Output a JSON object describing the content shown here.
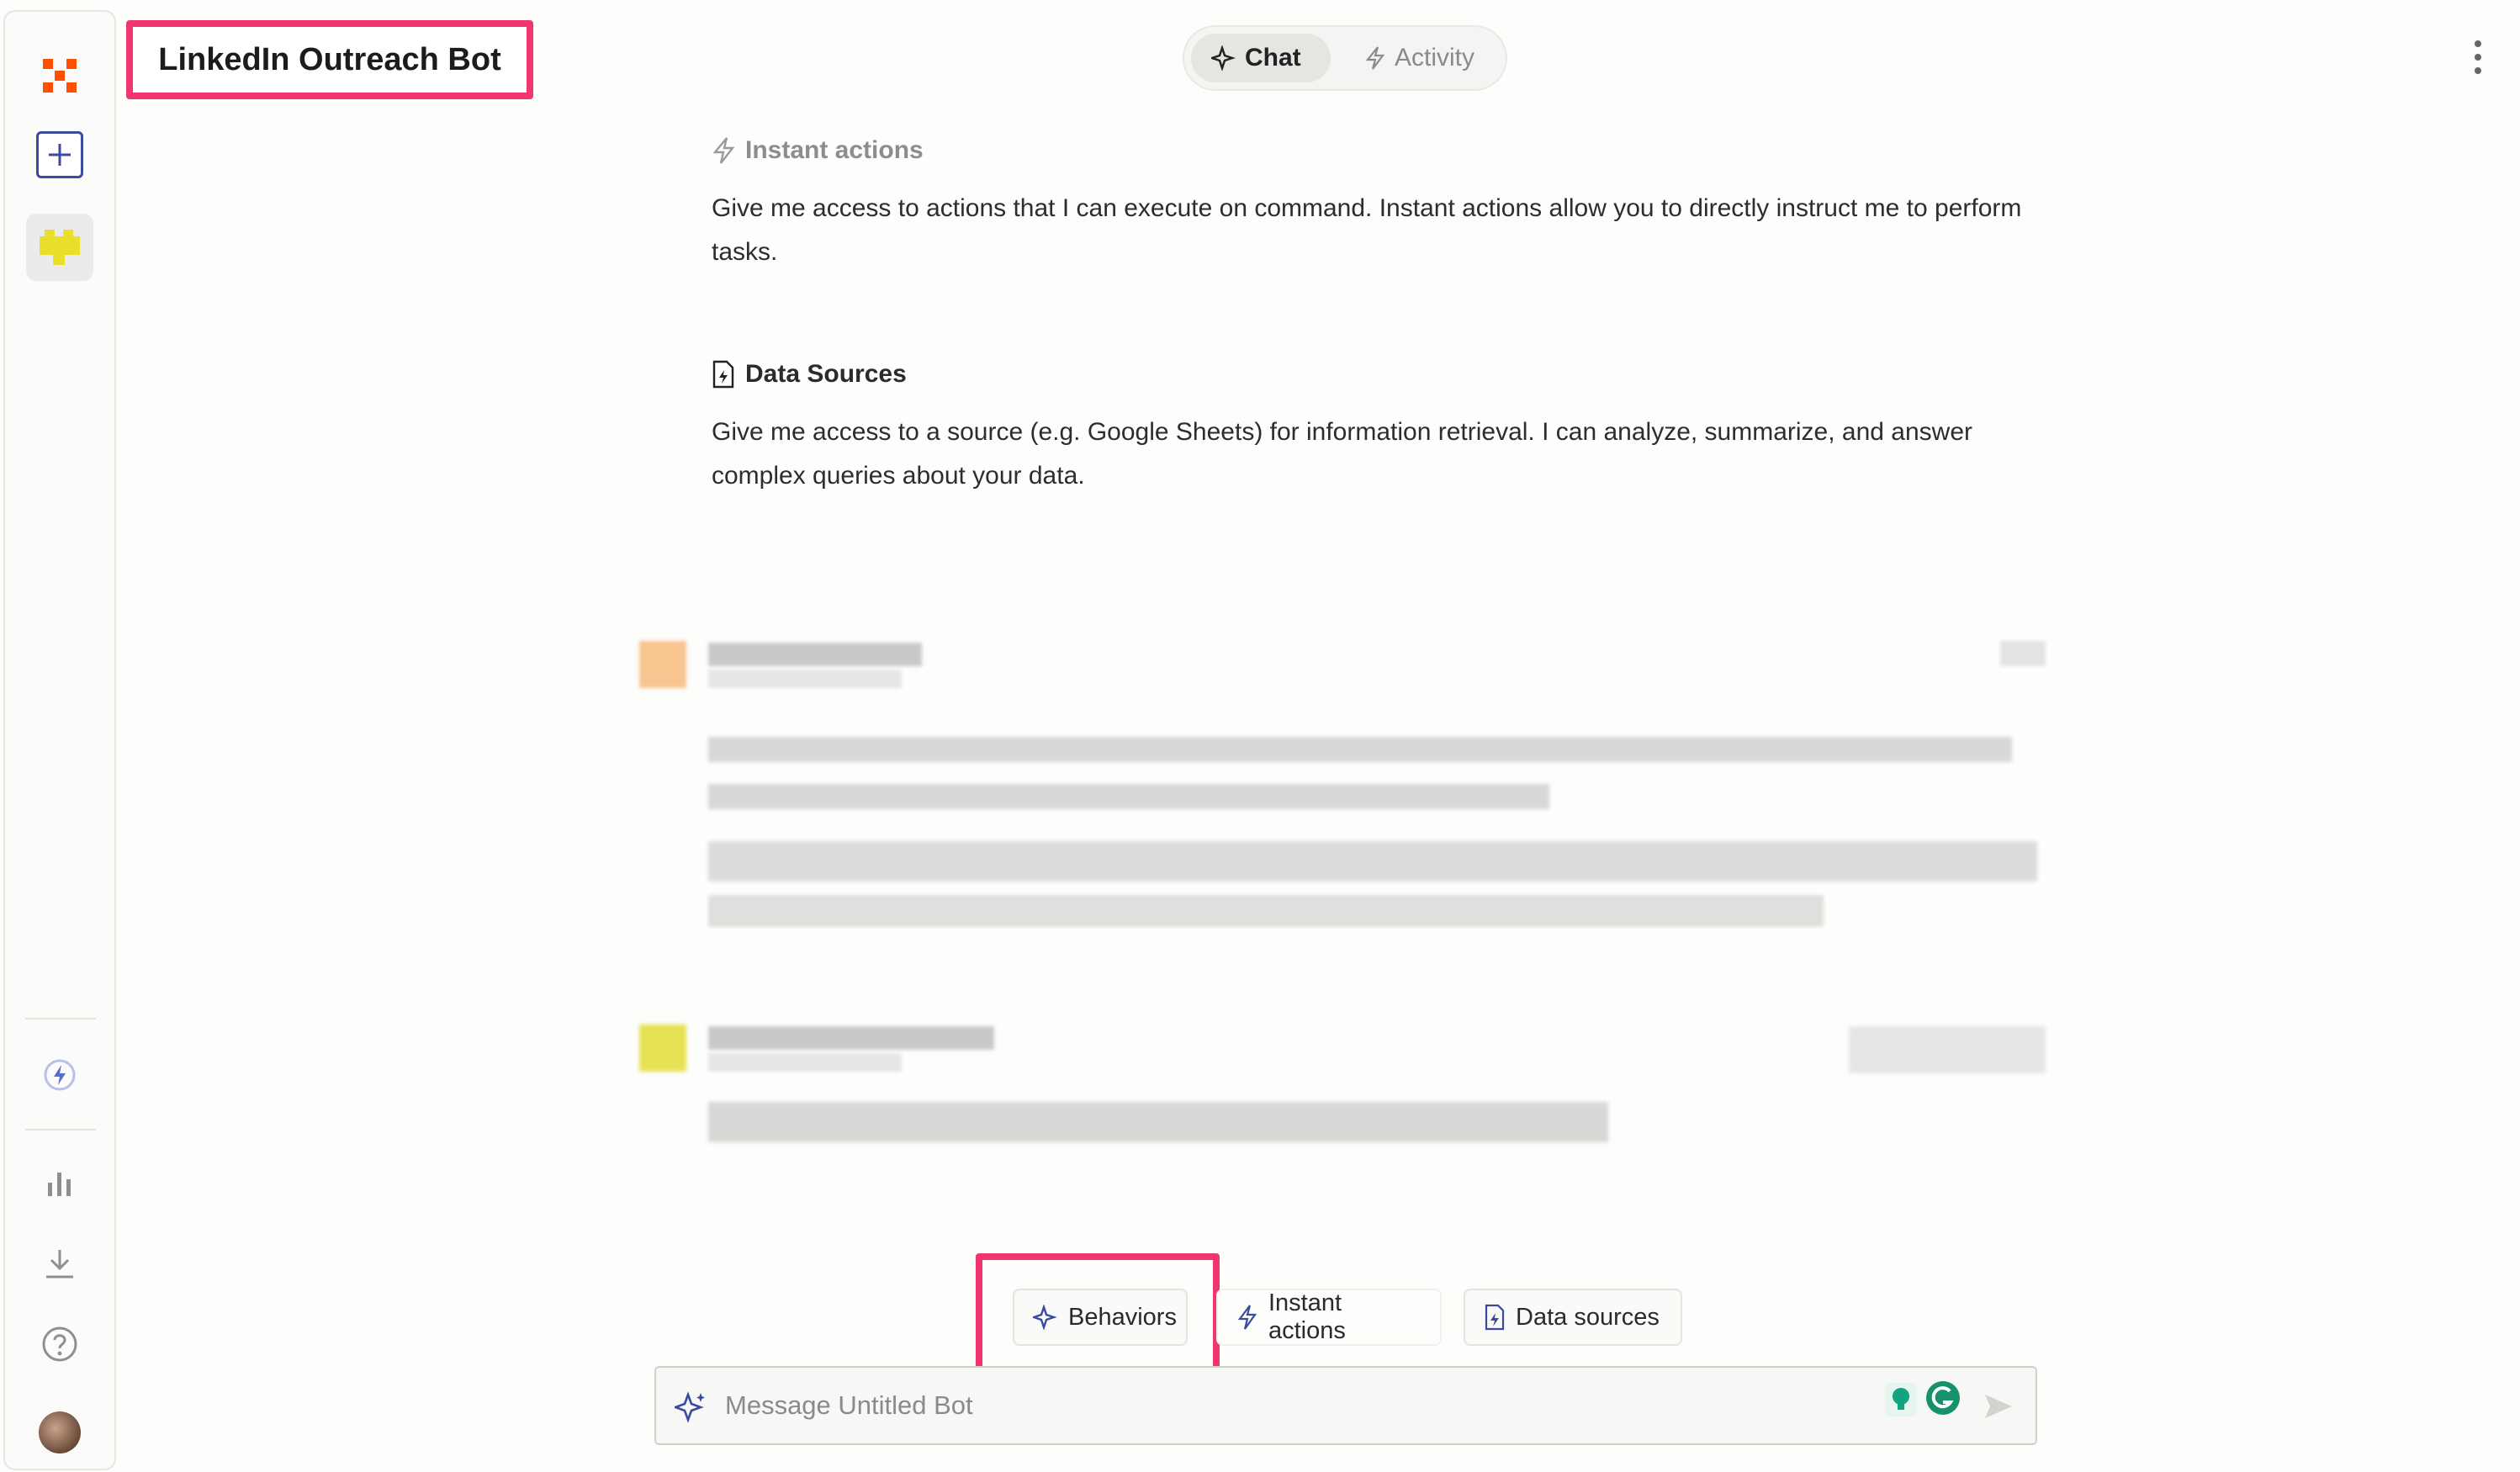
{
  "header": {
    "title": "LinkedIn Outreach Bot"
  },
  "tabs": [
    {
      "label": "Chat",
      "active": true
    },
    {
      "label": "Activity",
      "active": false
    }
  ],
  "sections": [
    {
      "heading": "Instant actions",
      "icon": "bolt-icon",
      "body": "Give me access to actions that I can execute on command. Instant actions allow you to directly instruct me to perform tasks."
    },
    {
      "heading": "Data Sources",
      "icon": "file-bolt-icon",
      "body": "Give me access to a source (e.g. Google Sheets) for information retrieval. I can analyze, summarize, and answer complex queries about your data."
    }
  ],
  "chips": [
    {
      "label": "Behaviors",
      "icon": "sparkle-icon"
    },
    {
      "label": "Instant actions",
      "icon": "bolt-icon"
    },
    {
      "label": "Data sources",
      "icon": "file-bolt-icon"
    }
  ],
  "composer": {
    "placeholder": "Message Untitled Bot"
  },
  "colors": {
    "accent": "#3a4a9e",
    "highlight": "#f0356f",
    "brand_orange": "#ff4f00"
  }
}
